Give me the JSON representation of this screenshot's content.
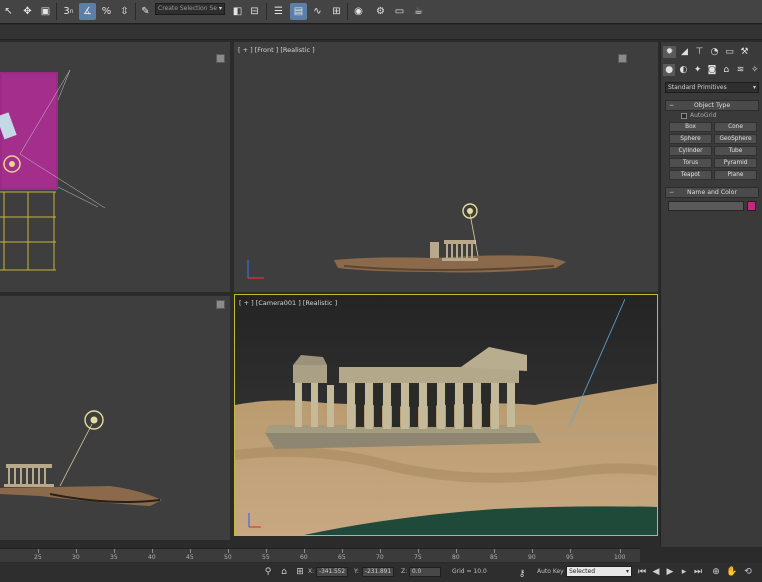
{
  "toolbar": {
    "selection_set_placeholder": "Create Selection Se",
    "icons": [
      "cursor-icon",
      "move-icon",
      "select-region-icon",
      "snap-3-icon",
      "angle-snap-icon",
      "percent-snap-icon",
      "spinner-snap-icon",
      "edit-named-selection-icon",
      "mirror-icon",
      "align-icon",
      "layers-icon",
      "scene-explorer-icon",
      "curve-editor-icon",
      "schematic-view-icon",
      "material-editor-icon",
      "render-setup-icon",
      "rendered-frame-icon",
      "render-icon"
    ]
  },
  "viewports": {
    "front_label": "[ + ] [Front ] [Realistic ]",
    "camera_label": "[ + ] [Camera001 ] [Realistic ]"
  },
  "command_panel": {
    "primitive_type": "Standard Primitives",
    "object_type_title": "Object Type",
    "autogrid_label": "AutoGrid",
    "objects": [
      "Box",
      "Cone",
      "Sphere",
      "GeoSphere",
      "Cylinder",
      "Tube",
      "Torus",
      "Pyramid",
      "Teapot",
      "Plane"
    ],
    "name_color_title": "Name and Color",
    "object_color": "#c8267e"
  },
  "timeline": {
    "ticks": [
      "25",
      "30",
      "35",
      "40",
      "45",
      "50",
      "55",
      "60",
      "65",
      "70",
      "75",
      "80",
      "85",
      "90",
      "95",
      "100"
    ]
  },
  "status": {
    "x_label": "X:",
    "x_value": "-341.552",
    "y_label": "Y:",
    "y_value": "-231.891",
    "z_label": "Z:",
    "z_value": "0.0",
    "grid_text": "Grid = 10.0",
    "autokey_label": "Auto Key",
    "selected_value": "Selected"
  }
}
